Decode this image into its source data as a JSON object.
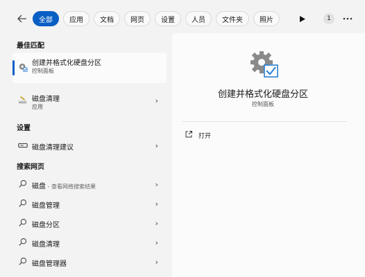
{
  "topbar": {
    "tabs": [
      {
        "label": "全部",
        "active": true
      },
      {
        "label": "应用"
      },
      {
        "label": "文档"
      },
      {
        "label": "网页"
      },
      {
        "label": "设置"
      },
      {
        "label": "人员"
      },
      {
        "label": "文件夹"
      },
      {
        "label": "照片"
      }
    ],
    "badge_count": "1",
    "icons": {
      "back": "back-arrow-icon",
      "play": "play-icon",
      "more": "more-icon"
    }
  },
  "left": {
    "best_match_header": "最佳匹配",
    "best_match": {
      "title": "创建并格式化硬盘分区",
      "subtitle": "控制面板",
      "icon": "control-panel-gear-icon"
    },
    "app_result": {
      "title": "磁盘清理",
      "subtitle": "应用",
      "icon": "disk-cleanup-icon"
    },
    "settings_header": "设置",
    "settings_items": [
      {
        "title": "磁盘清理建议",
        "icon": "drive-icon"
      }
    ],
    "web_header": "搜索网页",
    "web_items": [
      {
        "title": "磁盘",
        "suffix": " - 查看网络搜索结果"
      },
      {
        "title": "磁盘管理"
      },
      {
        "title": "磁盘分区"
      },
      {
        "title": "磁盘清理"
      },
      {
        "title": "磁盘管理器"
      }
    ]
  },
  "right": {
    "app_name": "创建并格式化硬盘分区",
    "app_type": "控制面板",
    "action_label": "打开",
    "accent_color": "#0a5fc4"
  }
}
